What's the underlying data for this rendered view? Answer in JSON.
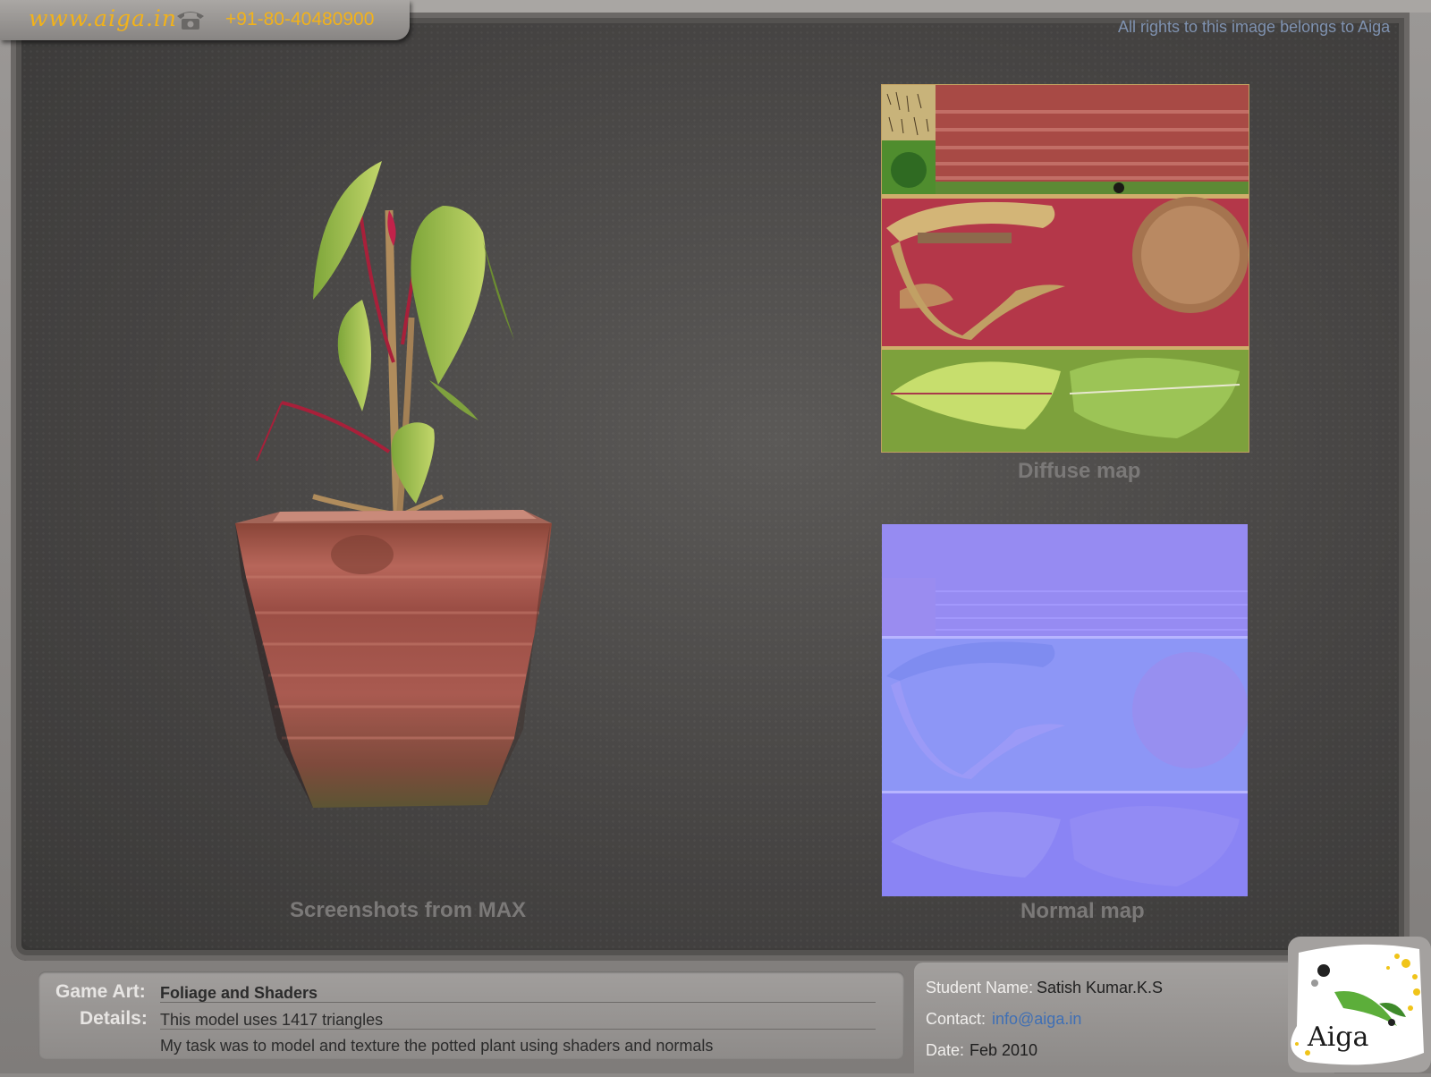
{
  "header": {
    "site_url": "www.aiga.in",
    "phone": "+91-80-40480900"
  },
  "rights_text": "All rights to this image belongs to Aiga",
  "captions": {
    "model": "Screenshots from MAX",
    "diffuse": "Diffuse map",
    "normal": "Normal map"
  },
  "info": {
    "game_art_label": "Game Art:",
    "game_art_value": "Foliage and Shaders",
    "details_label": "Details:",
    "detail_line1": "This model uses  1417 triangles",
    "detail_line2": "My task was to model and texture  the potted plant using shaders and normals"
  },
  "student": {
    "name_label": "Student Name:",
    "name_value": "Satish Kumar.K.S",
    "contact_label": "Contact:",
    "contact_value": "info@aiga.in",
    "date_label": "Date:",
    "date_value": "Feb 2010"
  },
  "logo_text": "Aiga",
  "icons": {
    "phone": "phone-icon"
  },
  "colors": {
    "accent_yellow": "#f2b21a",
    "rights_blue": "#7f92b0",
    "link_blue": "#3f6fb5"
  }
}
